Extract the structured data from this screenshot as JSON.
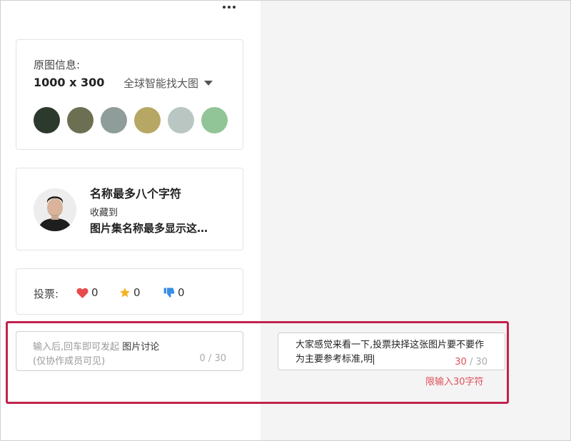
{
  "original_info": {
    "label": "原图信息:",
    "size": "1000 x 300",
    "find_label": "全球智能找大图",
    "swatches": [
      "#2c3a2e",
      "#6d6f52",
      "#8e9d99",
      "#b6a864",
      "#b9c6c1",
      "#91c597"
    ]
  },
  "author": {
    "name": "名称最多八个字符",
    "collect_label": "收藏到",
    "album": "图片集名称最多显示这…"
  },
  "vote": {
    "label": "投票:",
    "likes": "0",
    "stars": "0",
    "dislikes": "0"
  },
  "discussion_input": {
    "placeholder_prefix": "输入后,回车即可发起",
    "placeholder_highlight": "图片讨论",
    "placeholder_line2": "(仅协作成员可见)",
    "counter": "0 / 30"
  },
  "discussion_filled": {
    "text": "大家感觉来看一下,投票抉择这张图片要不要作为主要参考标准,明",
    "count": "30",
    "max": " / 30",
    "limit_hint": "限输入30字符"
  },
  "colors": {
    "highlight_border": "#c2234d",
    "error_red": "#e0505a",
    "heart": "#e84b4b",
    "star": "#f2b422",
    "thumb_down": "#3a8ee6"
  }
}
